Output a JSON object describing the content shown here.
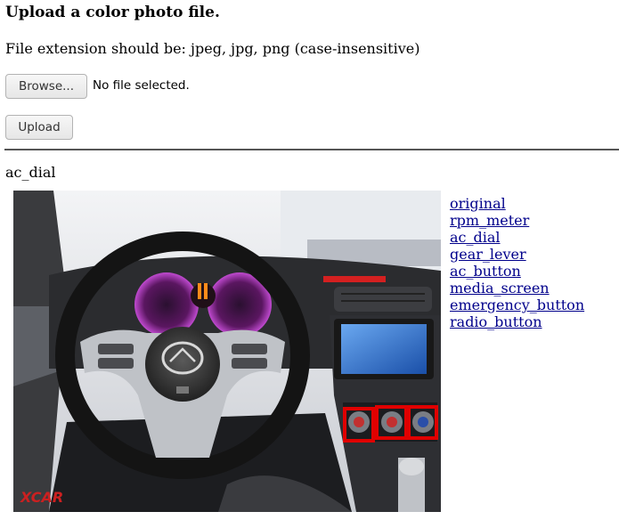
{
  "page": {
    "title": "Upload a color photo file.",
    "extension_note": "File extension should be: jpeg, jpg, png (case-insensitive)"
  },
  "form": {
    "browse_label": "Browse...",
    "file_status": "No file selected.",
    "upload_label": "Upload"
  },
  "result": {
    "caption": "ac_dial",
    "watermark": "XCAR",
    "highlight_color": "#e00000",
    "links": [
      "original",
      "rpm_meter",
      "ac_dial",
      "gear_lever",
      "ac_button",
      "media_screen",
      "emergency_button",
      "radio_button"
    ]
  }
}
